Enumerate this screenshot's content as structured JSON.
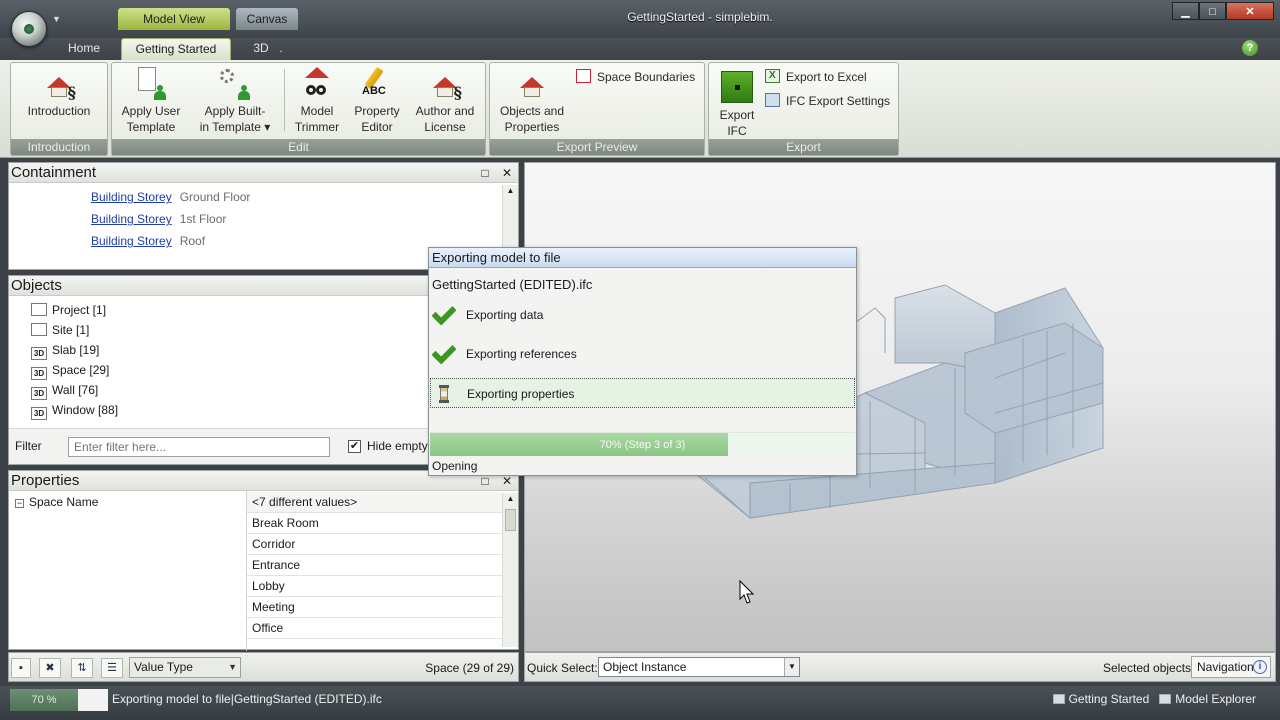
{
  "window": {
    "title": "GettingStarted - simplebim.",
    "context_tabs": [
      "Model View",
      "Canvas"
    ],
    "controls": {
      "minimize": "▁",
      "maximize": "□",
      "close": "✕"
    }
  },
  "ribbon": {
    "tabs": [
      "Home",
      "Getting Started",
      "3D",
      "."
    ],
    "active_tab": "Getting Started",
    "help_icon": "?",
    "groups": {
      "introduction": {
        "label": "Introduction",
        "button": "Introduction"
      },
      "edit": {
        "label": "Edit",
        "buttons": [
          {
            "line1": "Apply User",
            "line2": "Template"
          },
          {
            "line1": "Apply Built-",
            "line2": "in Template ▾"
          },
          {
            "line1": "Model",
            "line2": "Trimmer"
          },
          {
            "line1": "Property",
            "line2": "Editor"
          },
          {
            "line1": "Author and",
            "line2": "License"
          }
        ]
      },
      "export_preview": {
        "label": "Export Preview",
        "big_button": {
          "line1": "Objects and",
          "line2": "Properties"
        },
        "small_button": "Space Boundaries"
      },
      "export": {
        "label": "Export",
        "big_button": {
          "line1": "Export",
          "line2": "IFC"
        },
        "small_buttons": [
          "Export to Excel",
          "IFC Export Settings"
        ]
      }
    }
  },
  "containment": {
    "title": "Containment",
    "rows": [
      {
        "type": "Building Storey",
        "name": "Ground Floor"
      },
      {
        "type": "Building Storey",
        "name": "1st Floor"
      },
      {
        "type": "Building Storey",
        "name": "Roof"
      }
    ]
  },
  "objects": {
    "title": "Objects",
    "items": [
      {
        "icon": "grid",
        "label": "Project [1]"
      },
      {
        "icon": "grid",
        "label": "Site [1]"
      },
      {
        "icon": "3D",
        "label": "Slab [19]"
      },
      {
        "icon": "3D",
        "label": "Space [29]"
      },
      {
        "icon": "3D",
        "label": "Wall [76]"
      },
      {
        "icon": "3D",
        "label": "Window [88]"
      }
    ],
    "filter_label": "Filter",
    "filter_placeholder": "Enter filter here...",
    "hide_empty_label": "Hide empty",
    "hide_empty_checked": true
  },
  "properties": {
    "title": "Properties",
    "property_name": "Space Name",
    "values": [
      "<7 different values>",
      "Break Room",
      "Corridor",
      "Entrance",
      "Lobby",
      "Meeting",
      "Office"
    ],
    "value_type": "Value Type",
    "space_count": "Space (29 of 29)"
  },
  "quick_select": {
    "label": "Quick Select:",
    "value": "Object Instance",
    "selected_objects": "Selected objects",
    "navigation": "Navigation"
  },
  "export_dialog": {
    "title": "Exporting model to file",
    "file": "GettingStarted (EDITED).ifc",
    "steps": [
      {
        "label": "Exporting data",
        "state": "done"
      },
      {
        "label": "Exporting references",
        "state": "done"
      },
      {
        "label": "Exporting properties",
        "state": "in-progress"
      }
    ],
    "progress_fraction": 0.7,
    "progress_text": "70% (Step 3 of 3)",
    "status": "Opening"
  },
  "statusbar": {
    "progress_text": "70 %",
    "message": "Exporting model to file|GettingStarted (EDITED).ifc",
    "tabs": [
      "Getting Started",
      "Model Explorer"
    ]
  },
  "colors": {
    "accent_green": "#3d9622",
    "link_blue": "#1f3ea5",
    "close_red": "#c24a31"
  }
}
